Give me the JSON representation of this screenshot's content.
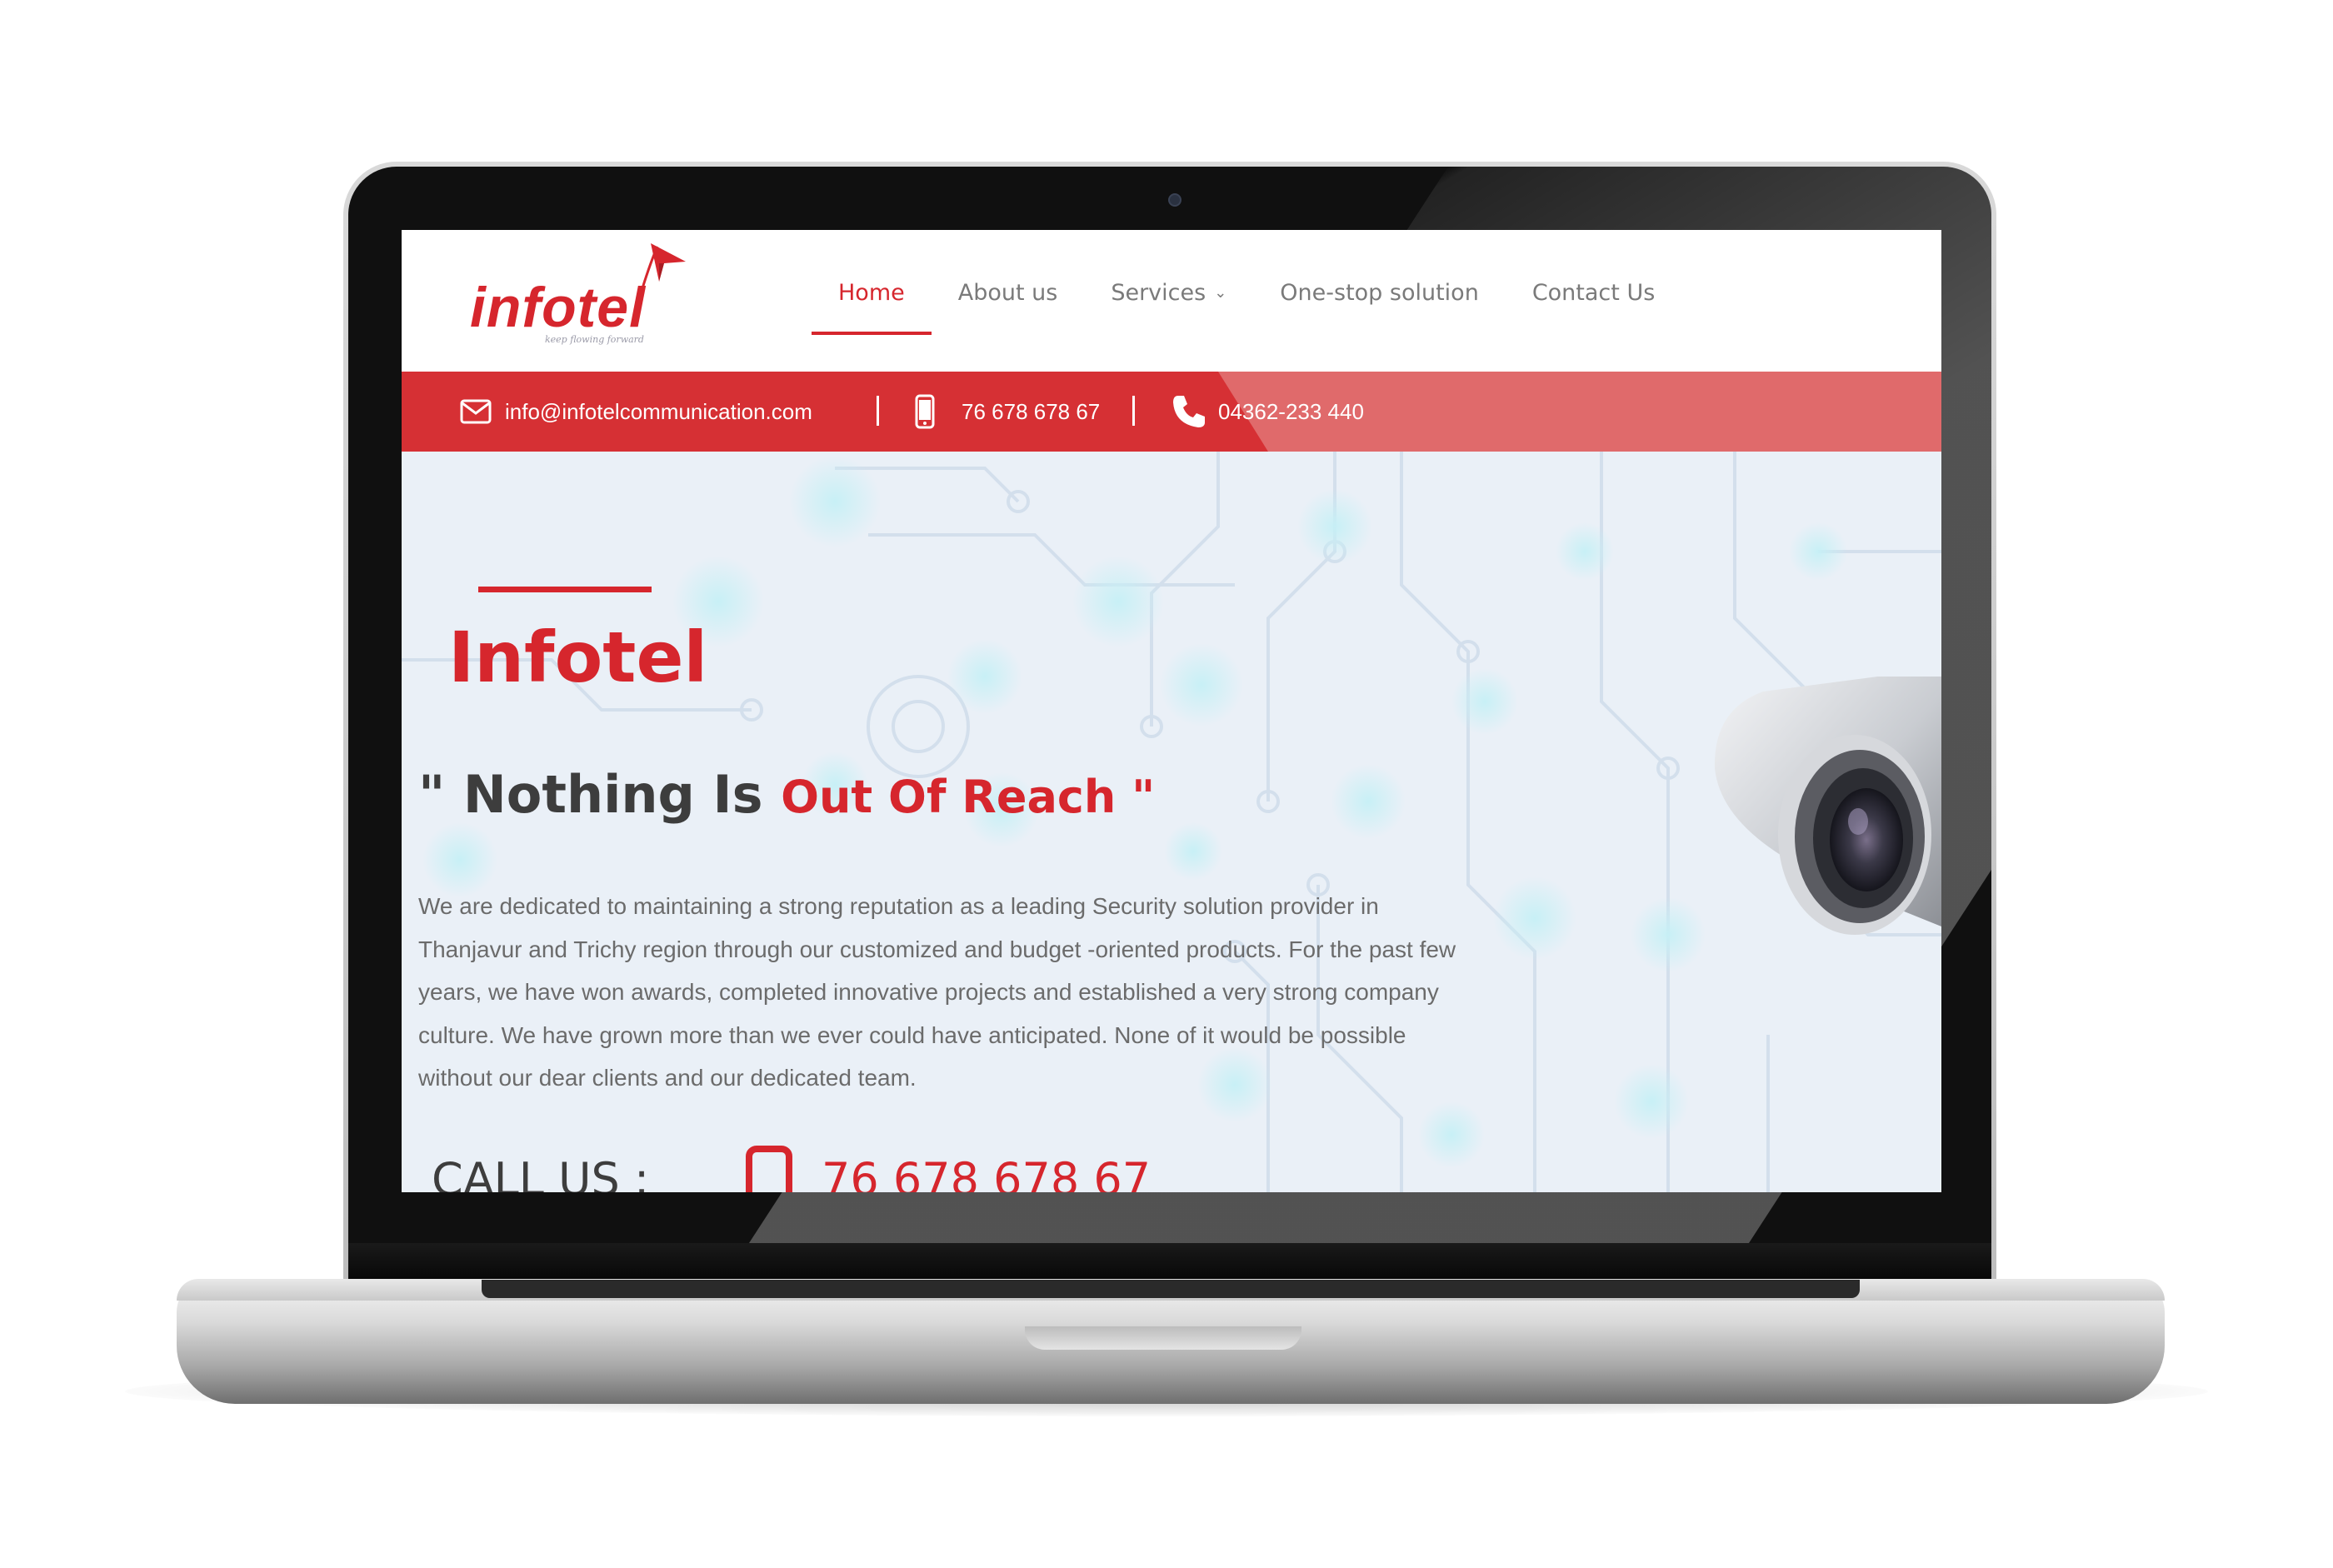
{
  "site": {
    "logo": {
      "text": "infotel",
      "tagline": "keep flowing forward"
    },
    "nav": {
      "items": [
        {
          "label": "Home",
          "active": true
        },
        {
          "label": "About us"
        },
        {
          "label": "Services",
          "has_dropdown": true
        },
        {
          "label": "One-stop solution"
        },
        {
          "label": "Contact Us"
        }
      ]
    },
    "contact_bar": {
      "email": "info@infotelcommunication.com",
      "mobile": "76 678 678 67",
      "phone": "04362-233 440",
      "separator": "|"
    },
    "hero": {
      "title": "Infotel",
      "tagline_prefix": "\" Nothing Is",
      "tagline_highlight": "Out Of Reach \"",
      "intro": "We are dedicated to maintaining a strong reputation as a leading  Security solution provider in Thanjavur and Trichy region through our customized and budget -oriented products. For the past few years, we have won awards, completed innovative projects and established a very strong company culture. We have grown more than we ever could have anticipated. None of it would be possible without our dear clients and our dedicated team.",
      "call_label": "CALL US :",
      "call_number": "76 678 678 67"
    }
  },
  "colors": {
    "brand_red": "#d6262d",
    "bar_light": "#e06a6b",
    "hero_bg": "#eaf0f7",
    "nav_text": "#7a7a7a"
  },
  "icons": [
    "envelope-icon",
    "mobile-phone-icon",
    "phone-handset-icon",
    "chevron-down-icon",
    "security-camera-image"
  ]
}
